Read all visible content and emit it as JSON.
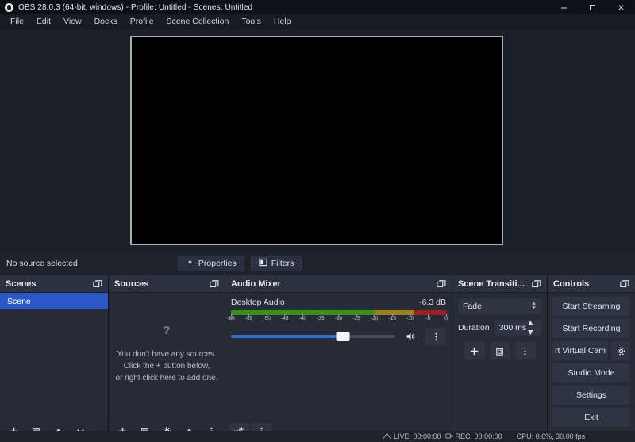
{
  "window": {
    "title": "OBS 28.0.3 (64-bit, windows) - Profile: Untitled - Scenes: Untitled",
    "logo_icon": "obs-logo-icon",
    "minimize_icon": "minimize-icon",
    "maximize_icon": "maximize-icon",
    "close_icon": "close-icon"
  },
  "menubar": {
    "items": [
      {
        "label": "File"
      },
      {
        "label": "Edit"
      },
      {
        "label": "View"
      },
      {
        "label": "Docks"
      },
      {
        "label": "Profile"
      },
      {
        "label": "Scene Collection"
      },
      {
        "label": "Tools"
      },
      {
        "label": "Help"
      }
    ]
  },
  "preview": {
    "canvas_background": "#000000",
    "border_color": "#a8adb8"
  },
  "source_toolbar": {
    "status_label": "No source selected",
    "properties_label": "Properties",
    "properties_icon": "gear-icon",
    "filters_label": "Filters",
    "filters_icon": "filters-icon"
  },
  "scenes": {
    "title": "Scenes",
    "float_icon": "float-dock-icon",
    "items": [
      {
        "label": "Scene",
        "selected": true
      }
    ],
    "selection_color": "#2a58c8",
    "toolbar": [
      {
        "icon": "plus-icon",
        "name": "add-scene-button"
      },
      {
        "icon": "trash-icon",
        "name": "remove-scene-button"
      },
      {
        "icon": "chevron-up-icon",
        "name": "move-scene-up-button"
      },
      {
        "icon": "chevron-down-icon",
        "name": "move-scene-down-button"
      }
    ]
  },
  "sources": {
    "title": "Sources",
    "float_icon": "float-dock-icon",
    "empty_icon": "question-mark-placeholder-icon",
    "empty_lines": [
      "You don't have any sources.",
      "Click the + button below,",
      "or right click here to add one."
    ],
    "toolbar": [
      {
        "icon": "plus-icon",
        "name": "add-source-button"
      },
      {
        "icon": "trash-icon",
        "name": "remove-source-button"
      },
      {
        "icon": "gear-icon",
        "name": "source-properties-button"
      },
      {
        "icon": "chevron-up-icon",
        "name": "move-source-up-button"
      },
      {
        "icon": "vertical-dots-icon",
        "name": "source-more-button"
      }
    ]
  },
  "audio_mixer": {
    "title": "Audio Mixer",
    "float_icon": "float-dock-icon",
    "channel": {
      "name": "Desktop Audio",
      "level_db": "-6.3 dB",
      "volume_percent": 68,
      "mute_icon": "speaker-icon",
      "menu_icon": "vertical-dots-icon"
    },
    "meter": {
      "ticks": [
        "-60",
        "-55",
        "-50",
        "-45",
        "-40",
        "-35",
        "-30",
        "-25",
        "-20",
        "-15",
        "-10",
        "-5",
        "0"
      ],
      "green_color": "#3a8f1e",
      "yellow_color": "#9a8021",
      "red_color": "#9b2026"
    },
    "toolbar": [
      {
        "icon": "advanced-audio-properties-icon",
        "name": "advanced-audio-button"
      },
      {
        "icon": "vertical-dots-icon",
        "name": "mixer-more-button"
      }
    ]
  },
  "scene_transitions": {
    "title": "Scene Transiti...",
    "float_icon": "float-dock-icon",
    "transition_value": "Fade",
    "duration_label": "Duration",
    "duration_value": "300 ms",
    "toolbar": [
      {
        "icon": "plus-icon",
        "name": "add-transition-button"
      },
      {
        "icon": "trash-icon",
        "name": "remove-transition-button"
      },
      {
        "icon": "vertical-dots-icon",
        "name": "transition-more-button"
      }
    ]
  },
  "controls": {
    "title": "Controls",
    "float_icon": "float-dock-icon",
    "buttons": [
      {
        "label": "Start Streaming",
        "name": "start-streaming-button"
      },
      {
        "label": "Start Recording",
        "name": "start-recording-button"
      },
      {
        "label": "rt Virtual Cam",
        "name": "start-virtual-cam-button"
      },
      {
        "label": "Studio Mode",
        "name": "studio-mode-button"
      },
      {
        "label": "Settings",
        "name": "settings-button"
      },
      {
        "label": "Exit",
        "name": "exit-button"
      }
    ],
    "virtual_cam_gear_icon": "gear-icon"
  },
  "statusbar": {
    "live_icon": "broadcast-icon",
    "live_label": "LIVE: 00:00:00",
    "rec_icon": "record-icon",
    "rec_label": "REC: 00:00:00",
    "cpu_label": "CPU: 0.6%, 30.00 fps"
  }
}
